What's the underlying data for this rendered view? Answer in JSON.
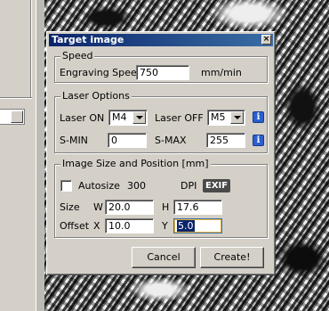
{
  "dialog": {
    "title": "Target image",
    "close_symbol": "×",
    "speed": {
      "group_title": "Speed",
      "engraving_speed_label": "Engraving Speed",
      "engraving_speed_value": "750",
      "unit": "mm/min"
    },
    "laser_options": {
      "group_title": "Laser Options",
      "laser_on_label": "Laser ON",
      "laser_on_value": "M4",
      "laser_off_label": "Laser OFF",
      "laser_off_value": "M5",
      "smin_label": "S-MIN",
      "smin_value": "0",
      "smax_label": "S-MAX",
      "smax_value": "255",
      "info_symbol": "i"
    },
    "image_size": {
      "group_title": "Image Size and Position [mm]",
      "autosize_label": "Autosize",
      "autosize_checked": false,
      "dpi_value": "300",
      "dpi_label": "DPI",
      "exif_label": "EXIF",
      "size_label": "Size",
      "w_label": "W",
      "w_value": "20.0",
      "h_label": "H",
      "h_value": "17.6",
      "offset_label": "Offset",
      "x_label": "X",
      "x_value": "10.0",
      "y_label": "Y",
      "y_value": "5.0"
    },
    "cancel_label": "Cancel",
    "create_label": "Create!"
  },
  "colors": {
    "titlebar_start": "#0a246a",
    "titlebar_end": "#3a6ea5",
    "info_button": "#2a5fd0",
    "face": "#d4d0c8"
  }
}
